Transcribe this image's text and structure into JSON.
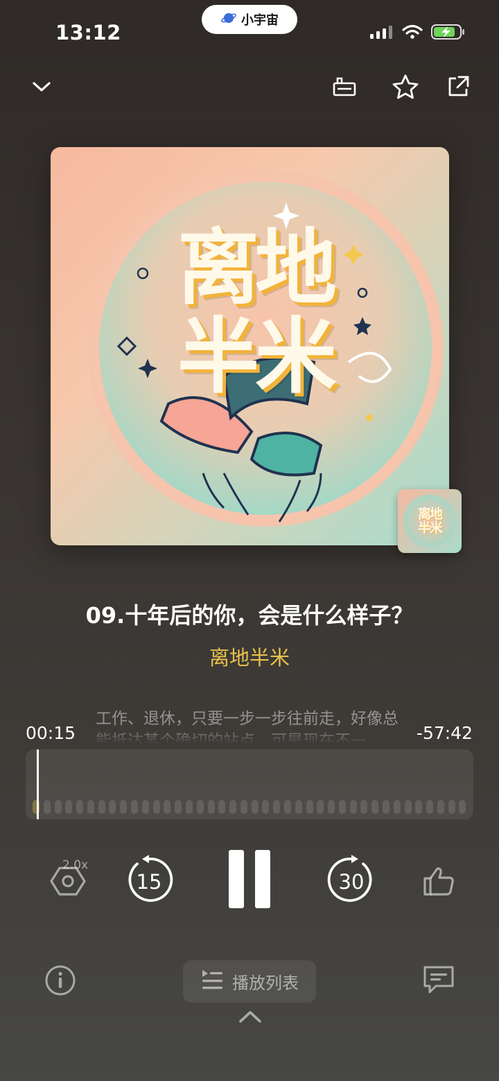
{
  "status_bar": {
    "time": "13:12",
    "pill_label": "小宇宙",
    "icons": [
      "cellular-signal-icon",
      "wifi-icon",
      "battery-charging-icon"
    ]
  },
  "top_bar": {
    "icons": [
      "chevron-down-icon",
      "cast-icon",
      "star-icon",
      "share-icon"
    ]
  },
  "artwork": {
    "cover_title_line1": "离地",
    "cover_title_line2": "半米"
  },
  "episode": {
    "title": "09.十年后的你，会是什么样子？",
    "podcast": "离地半米"
  },
  "transcript": {
    "preview": "工作、退休，只要一步一步往前走，好像总能抵达某个确切的站点，可是现在不一"
  },
  "progress": {
    "elapsed": "00:15",
    "remaining": "-57:42",
    "fraction_played": 0.004
  },
  "controls": {
    "speed": "2.0x",
    "rewind_seconds": "15",
    "forward_seconds": "30",
    "state": "playing"
  },
  "bottom": {
    "playlist_label": "播放列表"
  },
  "colors": {
    "accent_yellow": "#e9c24b",
    "background_top": "#2f2a27",
    "background_bottom": "#474745"
  }
}
